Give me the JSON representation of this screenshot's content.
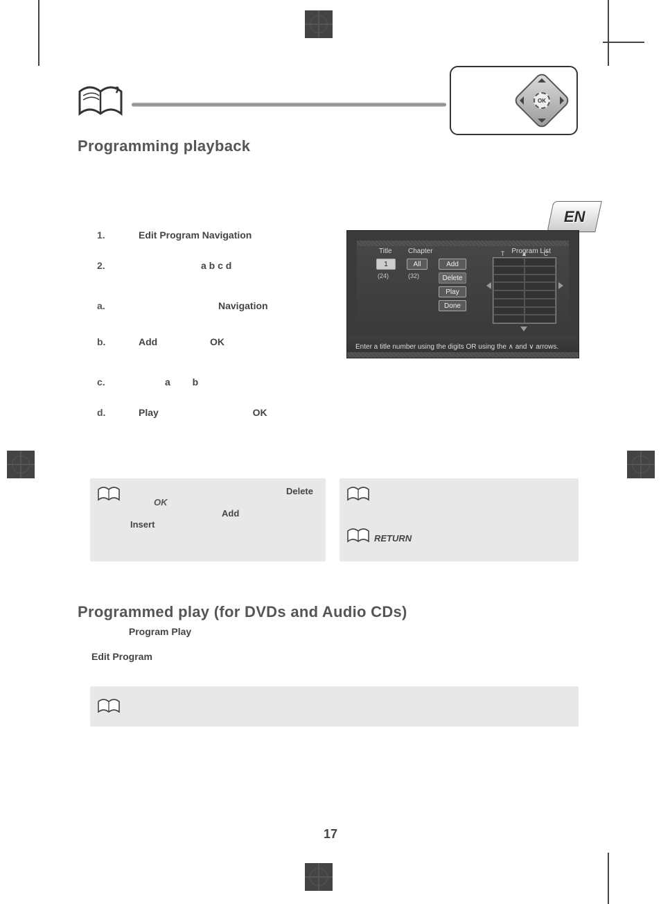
{
  "lang_tab": "EN",
  "remote_center": "OK",
  "section1_title": "Programming playback",
  "section2_title": "Programmed play (for DVDs and Audio CDs)",
  "steps": {
    "s1_num": "1.",
    "s1_a": "Edit Program",
    "s1_b": "Navigation",
    "s2_num": "2.",
    "s2_letters": "a  b  c  d",
    "sa_num": "a.",
    "sa_word": "Navigation",
    "sb_num": "b.",
    "sb_a": "Add",
    "sb_b": "OK",
    "sc_num": "c.",
    "sc_letters_a": "a",
    "sc_letters_b": "b",
    "sd_num": "d.",
    "sd_a": "Play",
    "sd_b": "OK"
  },
  "osd": {
    "title_hdr": "Title",
    "chapter_hdr": "Chapter",
    "proglist_hdr": "Program List",
    "title_val": "1",
    "chap_val": "All",
    "count1": "(24)",
    "count2": "(32)",
    "add": "Add",
    "delete": "Delete",
    "play": "Play",
    "done": "Done",
    "grid_hdr_t": "T",
    "grid_hdr_c": "C",
    "footer": "Enter a title number using the digits OR using the ∧ and ∨ arrows."
  },
  "note1": {
    "ok": "OK",
    "delete": "Delete",
    "add": "Add",
    "insert": "Insert"
  },
  "note2": {
    "return": "RETURN"
  },
  "para1_a": "Program Play",
  "para2_a": "Edit Program",
  "page_number": "17"
}
